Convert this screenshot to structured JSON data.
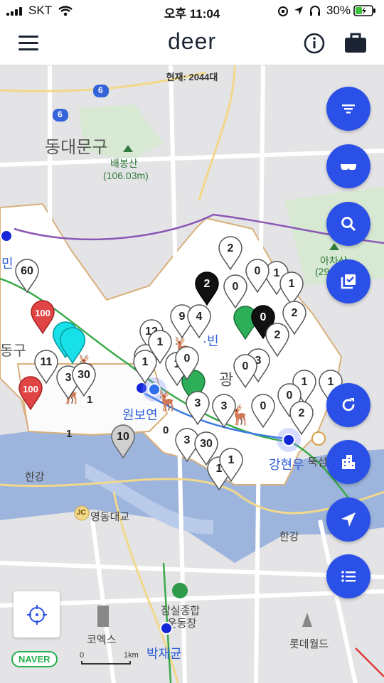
{
  "status_bar": {
    "carrier": "SKT",
    "time": "오후 11:04",
    "battery": "30%"
  },
  "header": {
    "title": "deer",
    "menu_icon": "hamburger-icon",
    "info_icon": "info-icon",
    "bag_icon": "briefcase-icon"
  },
  "map": {
    "current_count": "현재: 2044대",
    "labels": {
      "dongdaemun": "동대문구",
      "baebongsan": "배봉산",
      "baebongsan_height": "(106.03m)",
      "achasan": "아차산",
      "achasan_height": "(29",
      "jung_gu": "동구",
      "min": "민",
      "gwang": "광",
      "bin": "·빈",
      "wonbo": "원보연",
      "hangang_left": "한강",
      "hangang_right": "한강",
      "gangyeonwoo": "강현우",
      "ttukseom": "뚝섬",
      "yeongdong": "영동대교",
      "jc": "JC",
      "jamsil": "잠실종합",
      "jamsil2": "운동장",
      "bakjaegyun": "박재균",
      "coex": "코엑스",
      "lotteworld": "롯데월드",
      "route6a": "6",
      "route6b": "6"
    },
    "pins": [
      {
        "n": "60",
        "c": "white"
      },
      {
        "n": "100",
        "c": "red"
      },
      {
        "n": "100",
        "c": "red"
      },
      {
        "n": "11",
        "c": "white"
      },
      {
        "n": "3",
        "c": "white"
      },
      {
        "n": "30",
        "c": "white"
      },
      {
        "n": "12",
        "c": "white"
      },
      {
        "n": "9",
        "c": "white"
      },
      {
        "n": "4",
        "c": "white"
      },
      {
        "n": "1",
        "c": "white"
      },
      {
        "n": "1",
        "c": "white"
      },
      {
        "n": "0",
        "c": "white"
      },
      {
        "n": "2",
        "c": "white"
      },
      {
        "n": "0",
        "c": "white"
      },
      {
        "n": "1",
        "c": "white"
      },
      {
        "n": "0",
        "c": "white"
      },
      {
        "n": "1",
        "c": "white"
      },
      {
        "n": "2",
        "c": "black"
      },
      {
        "n": "0",
        "c": "black"
      },
      {
        "n": "2",
        "c": "white"
      },
      {
        "n": "2",
        "c": "white"
      },
      {
        "n": "3",
        "c": "white"
      },
      {
        "n": "0",
        "c": "white"
      },
      {
        "n": "1",
        "c": "white"
      },
      {
        "n": "1",
        "c": "white"
      },
      {
        "n": "0",
        "c": "white"
      },
      {
        "n": "2",
        "c": "white"
      },
      {
        "n": "3",
        "c": "white"
      },
      {
        "n": "3",
        "c": "white"
      },
      {
        "n": "0",
        "c": "white"
      },
      {
        "n": "3",
        "c": "white"
      },
      {
        "n": "30",
        "c": "white"
      },
      {
        "n": "1",
        "c": "white"
      },
      {
        "n": "1",
        "c": "white"
      },
      {
        "n": "10",
        "c": "gray"
      },
      {
        "n": "1",
        "c": "white"
      },
      {
        "n": "1",
        "c": "white"
      }
    ],
    "standalone_numbers": [
      "1",
      "1",
      "0"
    ]
  },
  "fabs": [
    "filter-icon",
    "glasses-icon",
    "search-icon",
    "checklist-icon",
    "refresh-icon",
    "building-icon",
    "navigate-icon",
    "list-icon"
  ],
  "locate_button_icon": "crosshair-icon",
  "naver_logo": "NAVER",
  "scale": {
    "zero": "0",
    "unit": "1km"
  },
  "colors": {
    "accent": "#2b50e8",
    "header_text": "#1c2434",
    "naver_green": "#22b14c"
  }
}
